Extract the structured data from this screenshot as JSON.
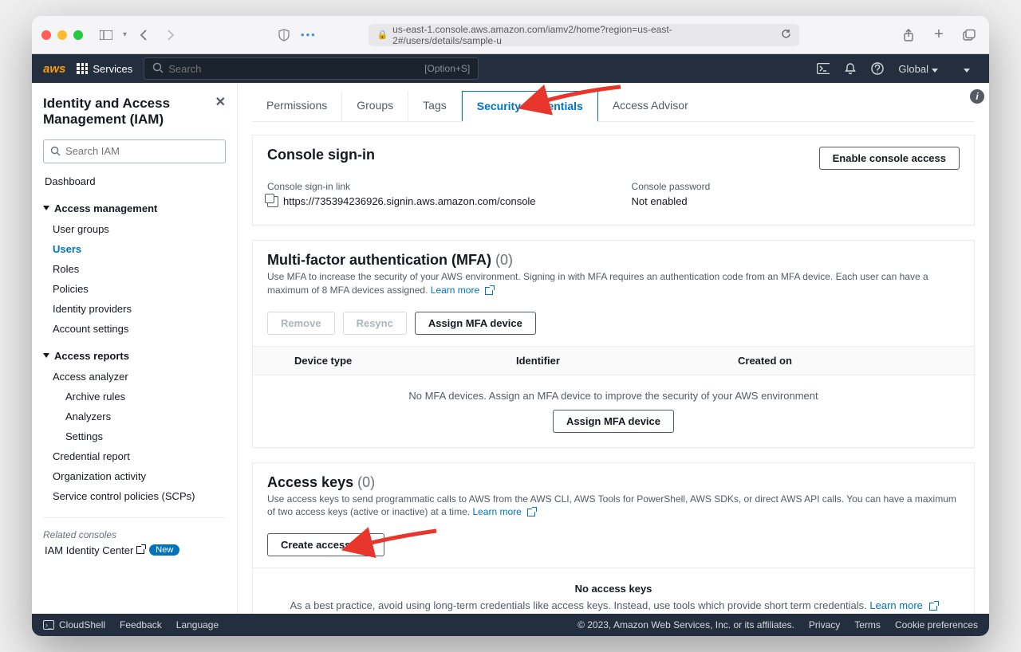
{
  "browser": {
    "url": "us-east-1.console.aws.amazon.com/iamv2/home?region=us-east-2#/users/details/sample-u"
  },
  "nav": {
    "logo": "aws",
    "services": "Services",
    "search_placeholder": "Search",
    "search_hint": "[Option+S]",
    "region": "Global"
  },
  "sidebar": {
    "title": "Identity and Access Management (IAM)",
    "search_placeholder": "Search IAM",
    "dashboard": "Dashboard",
    "section_access": "Access management",
    "items_access": [
      "User groups",
      "Users",
      "Roles",
      "Policies",
      "Identity providers",
      "Account settings"
    ],
    "active_item": "Users",
    "section_reports": "Access reports",
    "items_reports": [
      "Access analyzer",
      "Archive rules",
      "Analyzers",
      "Settings",
      "Credential report",
      "Organization activity",
      "Service control policies (SCPs)"
    ],
    "related_label": "Related consoles",
    "iam_identity": "IAM Identity Center",
    "new_badge": "New"
  },
  "tabs": [
    "Permissions",
    "Groups",
    "Tags",
    "Security credentials",
    "Access Advisor"
  ],
  "active_tab": "Security credentials",
  "console_signin": {
    "title": "Console sign-in",
    "button": "Enable console access",
    "link_label": "Console sign-in link",
    "link_value": "https://735394236926.signin.aws.amazon.com/console",
    "pwd_label": "Console password",
    "pwd_value": "Not enabled"
  },
  "mfa": {
    "title": "Multi-factor authentication (MFA)",
    "count": "(0)",
    "desc": "Use MFA to increase the security of your AWS environment. Signing in with MFA requires an authentication code from an MFA device. Each user can have a maximum of 8 MFA devices assigned.",
    "learn_more": "Learn more",
    "btn_remove": "Remove",
    "btn_resync": "Resync",
    "btn_assign": "Assign MFA device",
    "th_device": "Device type",
    "th_identifier": "Identifier",
    "th_created": "Created on",
    "empty": "No MFA devices. Assign an MFA device to improve the security of your AWS environment",
    "empty_btn": "Assign MFA device"
  },
  "access_keys": {
    "title": "Access keys",
    "count": "(0)",
    "desc": "Use access keys to send programmatic calls to AWS from the AWS CLI, AWS Tools for PowerShell, AWS SDKs, or direct AWS API calls. You can have a maximum of two access keys (active or inactive) at a time.",
    "learn_more": "Learn more",
    "btn_create": "Create access key",
    "empty_title": "No access keys",
    "empty_desc": "As a best practice, avoid using long-term credentials like access keys. Instead, use tools which provide short term credentials.",
    "empty_learn": "Learn more"
  },
  "footer": {
    "cloudshell": "CloudShell",
    "feedback": "Feedback",
    "language": "Language",
    "copyright": "© 2023, Amazon Web Services, Inc. or its affiliates.",
    "privacy": "Privacy",
    "terms": "Terms",
    "cookies": "Cookie preferences"
  }
}
